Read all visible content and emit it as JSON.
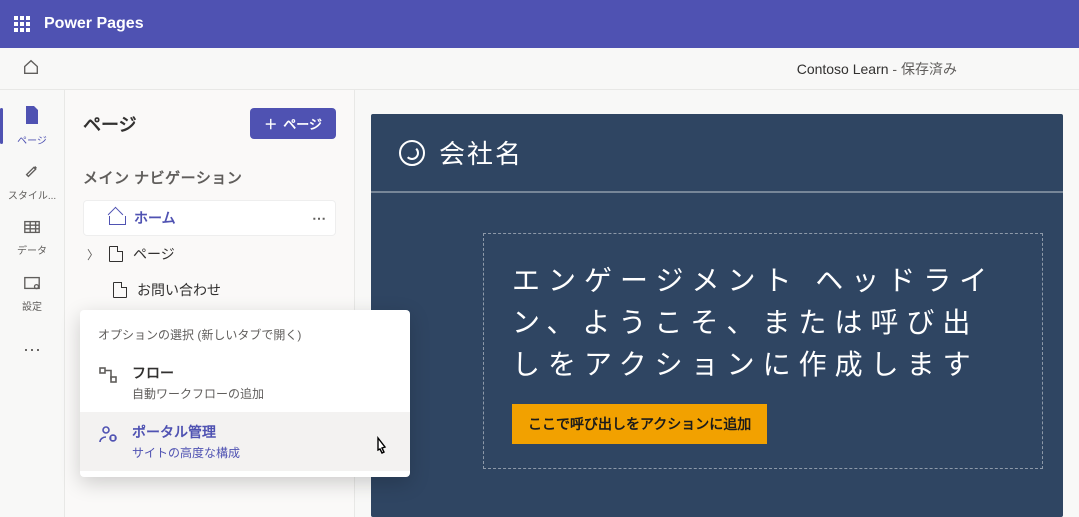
{
  "appbar": {
    "brand": "Power Pages"
  },
  "subbar": {
    "site_name": "Contoso Learn",
    "saved_suffix": " - 保存済み"
  },
  "rail": {
    "items": [
      {
        "label": "ページ",
        "icon": "page"
      },
      {
        "label": "スタイル...",
        "icon": "brush"
      },
      {
        "label": "データ",
        "icon": "table"
      },
      {
        "label": "設定",
        "icon": "gear"
      }
    ],
    "more_label": "..."
  },
  "panel": {
    "title": "ページ",
    "add_button": "ページ",
    "section": "メイン ナビゲーション",
    "tree": {
      "home": "ホーム",
      "pages": "ページ",
      "contact": "お問い合わせ"
    }
  },
  "flyout": {
    "heading": "オプションの選択 (新しいタブで開く)",
    "items": [
      {
        "title": "フロー",
        "subtitle": "自動ワークフローの追加"
      },
      {
        "title": "ポータル管理",
        "subtitle": "サイトの高度な構成"
      }
    ]
  },
  "canvas": {
    "company": "会社名",
    "headline": "エンゲージメント ヘッドライン、ようこそ、または呼び出しをアクションに作成します",
    "cta": "ここで呼び出しをアクションに追加"
  }
}
